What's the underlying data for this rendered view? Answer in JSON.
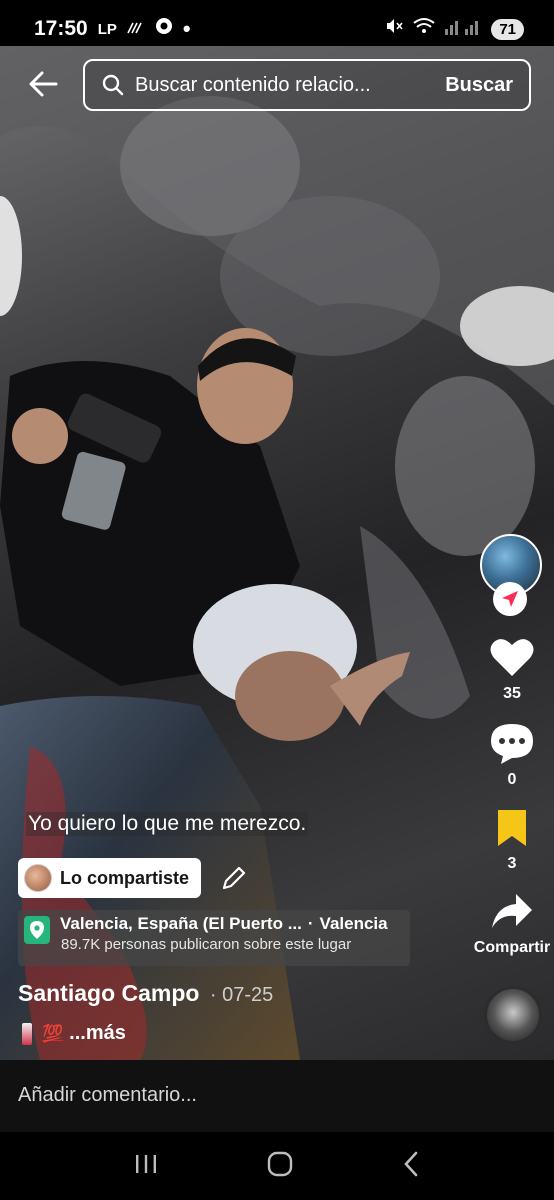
{
  "status_bar": {
    "time": "17:50",
    "carrier": "LP",
    "battery": "71"
  },
  "search": {
    "placeholder": "Buscar contenido relacio...",
    "button_label": "Buscar"
  },
  "actions": {
    "likes": "35",
    "comments": "0",
    "favorites": "3",
    "share_label": "Compartir"
  },
  "post": {
    "caption": "Yo quiero lo que me merezco.",
    "shared_label": "Lo compartiste",
    "location_name": "Valencia, España (El Puerto ...",
    "location_city": "Valencia",
    "location_sub": "89.7K personas publicaron sobre este lugar",
    "author": "Santiago Campo",
    "date": "· 07-25",
    "more": "...más"
  },
  "comment_bar": {
    "placeholder": "Añadir comentario..."
  },
  "colors": {
    "like": "#ffffff",
    "favorite": "#f5c518",
    "follow_badge": "#fe2c55",
    "location_pin": "#26b57a"
  }
}
